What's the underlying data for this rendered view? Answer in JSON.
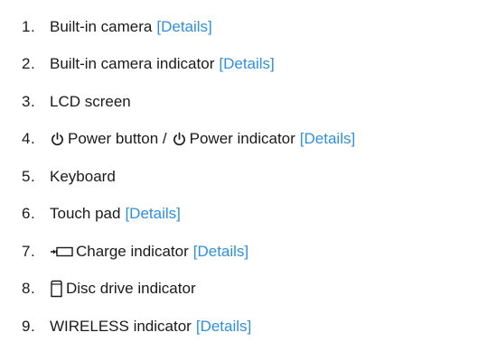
{
  "items": [
    {
      "num": "1.",
      "label": "Built-in camera",
      "link": "[Details]"
    },
    {
      "num": "2.",
      "label": "Built-in camera indicator",
      "link": "[Details]"
    },
    {
      "num": "3.",
      "label": "LCD screen"
    },
    {
      "num": "4.",
      "label_a": "Power button /",
      "label_b": "Power indicator",
      "link": "[Details]",
      "icon": "power-icon"
    },
    {
      "num": "5.",
      "label": "Keyboard"
    },
    {
      "num": "6.",
      "label": "Touch pad",
      "link": "[Details]"
    },
    {
      "num": "7.",
      "label": "Charge indicator",
      "link": "[Details]",
      "icon": "charge-battery-icon"
    },
    {
      "num": "8.",
      "label": "Disc drive indicator",
      "icon": "disc-drive-icon"
    },
    {
      "num": "9.",
      "label": "WIRELESS indicator",
      "link": "[Details]"
    }
  ],
  "colors": {
    "text": "#1a1a1a",
    "link": "#2f8fe0",
    "background": "#ffffff"
  }
}
